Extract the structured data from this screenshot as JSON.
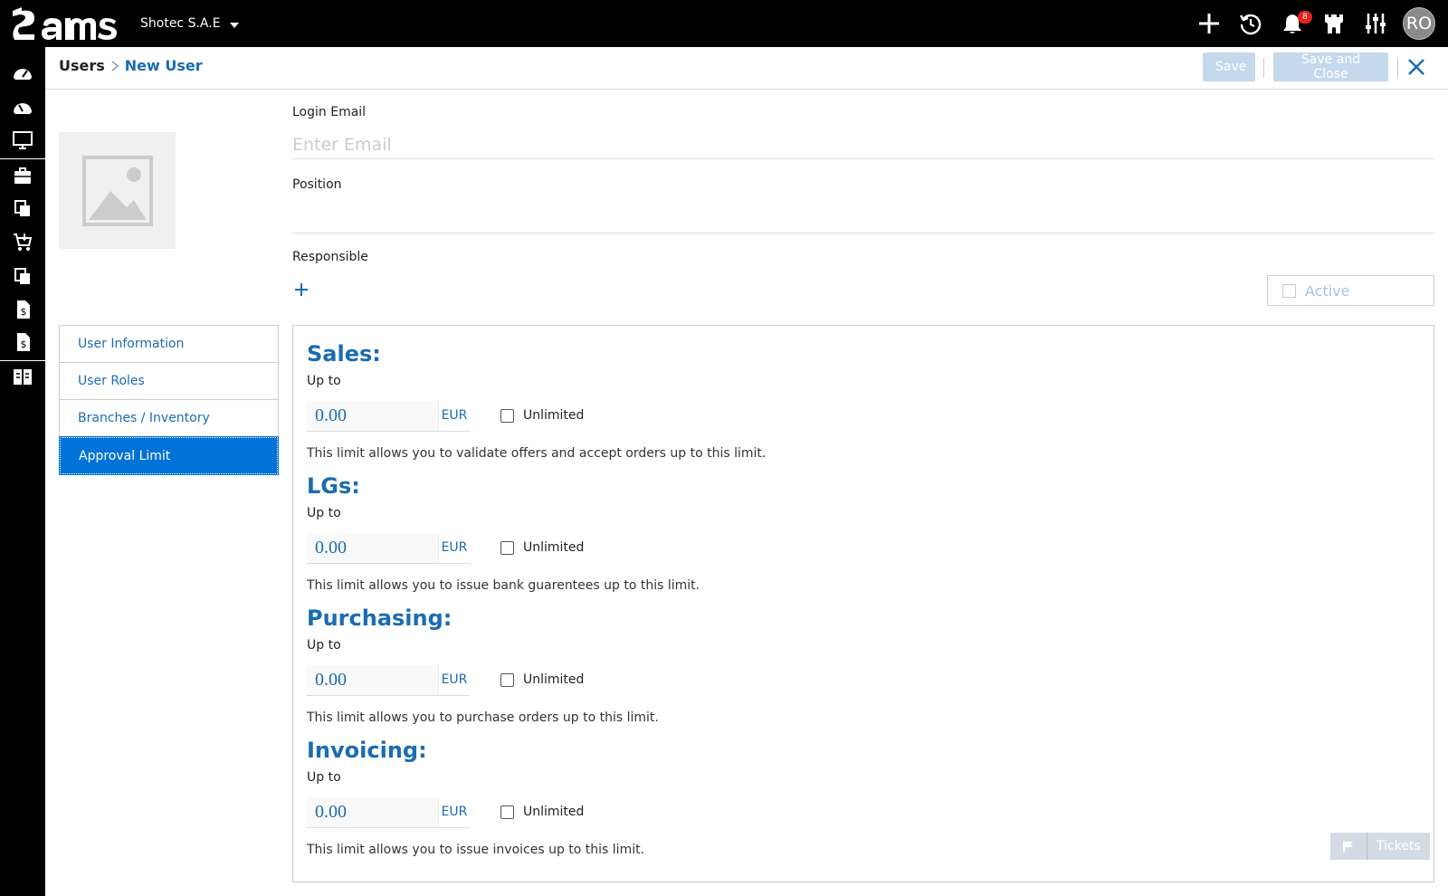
{
  "topbar": {
    "company": "Shotec S.A.E",
    "notifications_count": "8",
    "user_initials": "RO"
  },
  "header": {
    "breadcrumb_root": "Users",
    "breadcrumb_current": "New User",
    "save_label": "Save",
    "save_close_label": "Save and Close"
  },
  "form": {
    "login_email_label": "Login Email",
    "login_email_placeholder": "Enter Email",
    "position_label": "Position",
    "responsible_label": "Responsible",
    "active_label": "Active"
  },
  "tabs": [
    {
      "label": "User Information"
    },
    {
      "label": "User Roles"
    },
    {
      "label": "Branches / Inventory"
    },
    {
      "label": "Approval Limit"
    }
  ],
  "sections": [
    {
      "title": "Sales:",
      "upto": "Up to",
      "amount": "0.00",
      "currency": "EUR",
      "unlimited": "Unlimited",
      "desc": "This limit allows you to validate offers and accept orders up to this limit."
    },
    {
      "title": "LGs:",
      "upto": "Up to",
      "amount": "0.00",
      "currency": "EUR",
      "unlimited": "Unlimited",
      "desc": "This limit allows you to issue bank guarentees up to this limit."
    },
    {
      "title": "Purchasing:",
      "upto": "Up to",
      "amount": "0.00",
      "currency": "EUR",
      "unlimited": "Unlimited",
      "desc": "This limit allows you to purchase orders up to this limit."
    },
    {
      "title": "Invoicing:",
      "upto": "Up to",
      "amount": "0.00",
      "currency": "EUR",
      "unlimited": "Unlimited",
      "desc": "This limit allows you to issue invoices up to this limit."
    }
  ],
  "tickets_label": "Tickets",
  "colors": {
    "accent": "#1a6cb3",
    "active_tab": "#0072d8",
    "disabled_btn": "#c5d9ec"
  }
}
